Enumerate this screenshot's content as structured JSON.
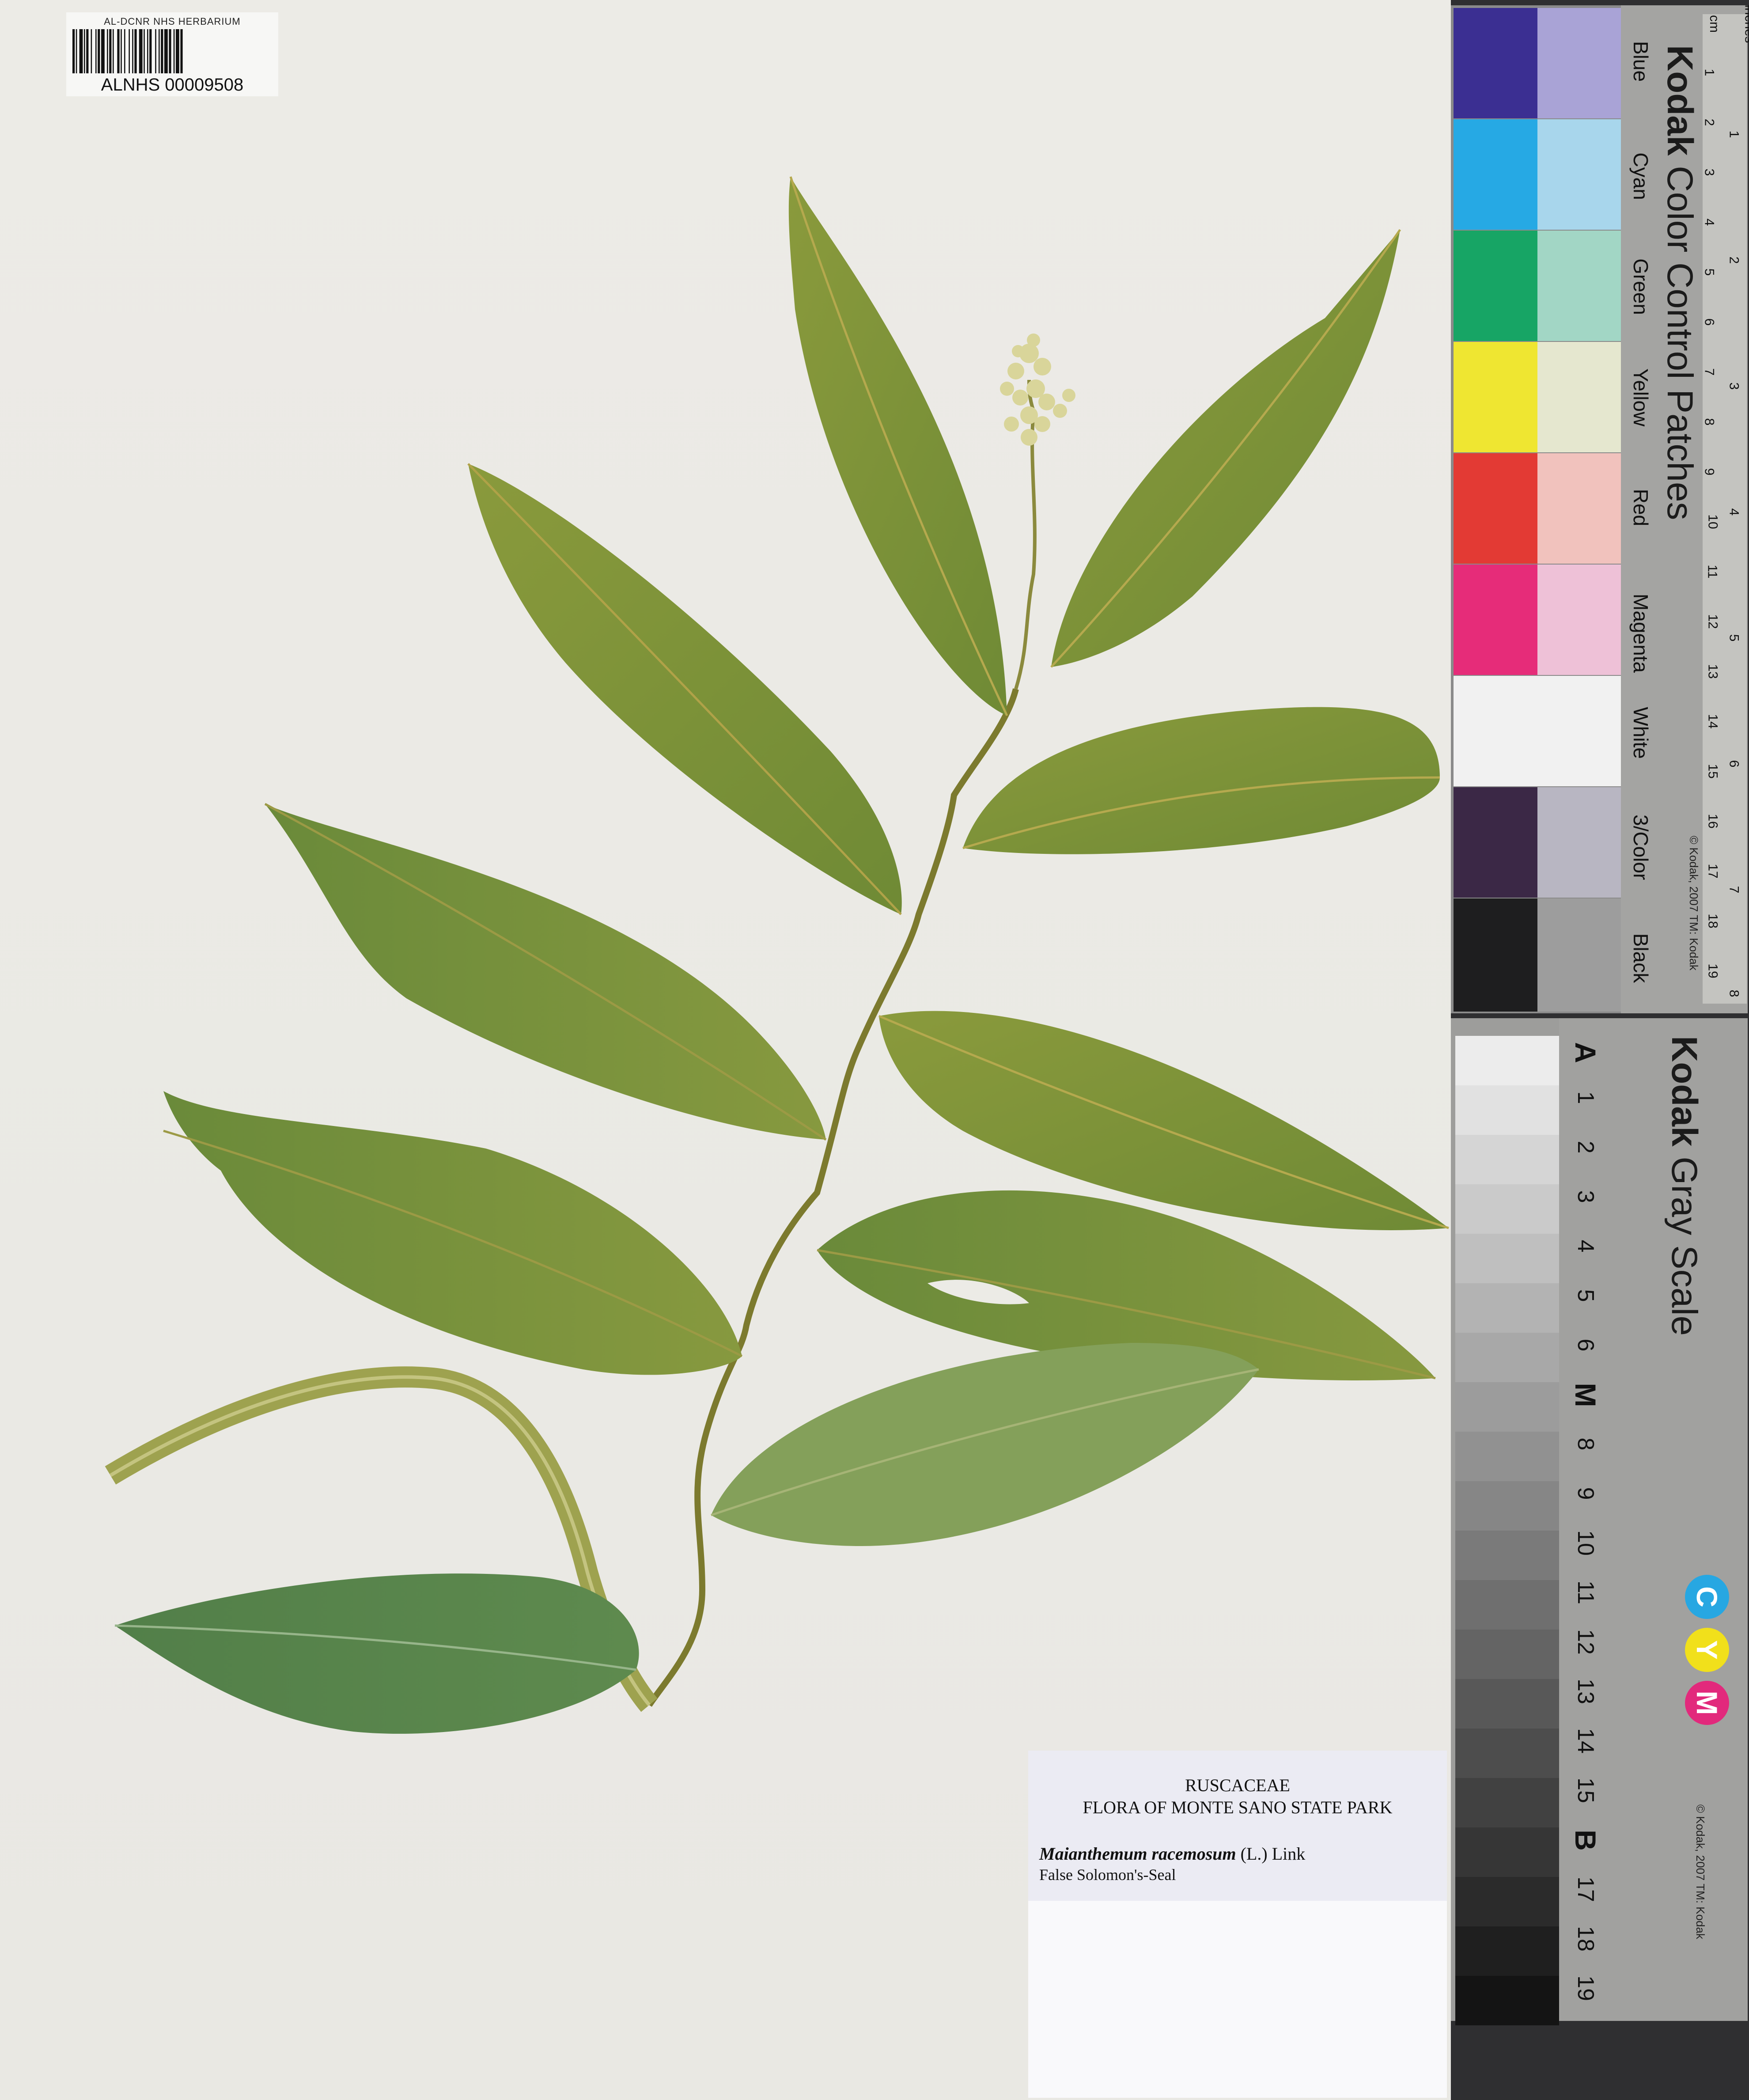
{
  "barcode": {
    "caption": "AL-DCNR NHS HERBARIUM",
    "number": "ALNHS 00009508"
  },
  "color_chart": {
    "brand": "Kodak",
    "title": "Color Control Patches",
    "names": [
      "Blue",
      "Cyan",
      "Green",
      "Yellow",
      "Red",
      "Magenta",
      "White",
      "3/Color",
      "Black"
    ],
    "copyright": "© Kodak, 2007 TM: Kodak",
    "units": [
      "cm",
      "inches"
    ],
    "cm_ticks": [
      "1",
      "2",
      "3",
      "4",
      "5",
      "6",
      "7",
      "8",
      "9",
      "10",
      "11",
      "12",
      "13",
      "14",
      "15",
      "16",
      "17",
      "18",
      "19"
    ],
    "inch_ticks": [
      "1",
      "2",
      "3",
      "4",
      "5",
      "6",
      "7",
      "8"
    ],
    "colors": {
      "blue": "#3b2f92",
      "blue_light": "#a9a3d6",
      "cyan": "#26a9e4",
      "cyan_light": "#a8d6ec",
      "green": "#17a565",
      "green_light": "#a2d6c5",
      "yellow": "#efe631",
      "yellow_light": "#e5e7cf",
      "red": "#e33a34",
      "red_light": "#f1c2bd",
      "magenta": "#e62c79",
      "magenta_light": "#eec1d7",
      "white": "#f1f1f1",
      "threecolor": "#3b2846",
      "threecolor_light": "#b8b6c2",
      "black": "#1e1e1f",
      "black_light": "#9d9d9d"
    }
  },
  "gray_scale": {
    "brand": "Kodak",
    "title": "Gray Scale",
    "steps": [
      "A",
      "1",
      "2",
      "3",
      "4",
      "5",
      "6",
      "M",
      "8",
      "9",
      "10",
      "11",
      "12",
      "13",
      "14",
      "15",
      "B",
      "17",
      "18",
      "19"
    ],
    "cym": [
      "C",
      "Y",
      "M"
    ],
    "cym_colors": [
      "#27a7e2",
      "#f1e01b",
      "#e2297c"
    ],
    "copyright": "© Kodak, 2007 TM: Kodak"
  },
  "label": {
    "family": "RUSCACEAE",
    "flora": "FLORA OF MONTE SANO STATE PARK",
    "scientific_name": "Maianthemum racemosum",
    "authority": "(L.) Link",
    "common_name": "False Solomon's-Seal"
  }
}
